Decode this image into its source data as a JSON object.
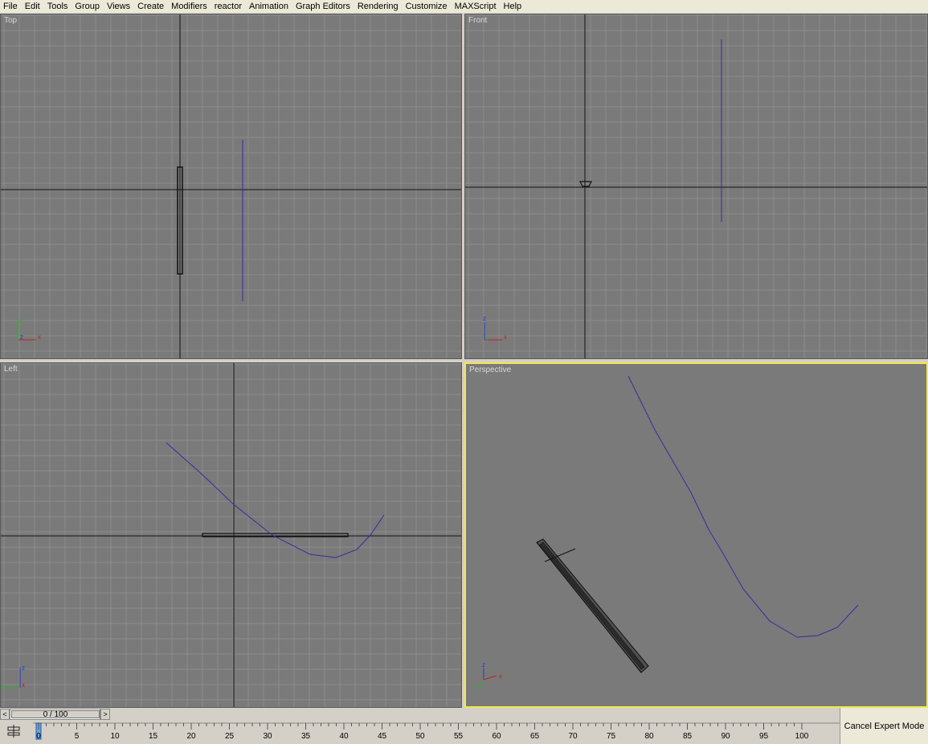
{
  "menu": [
    "File",
    "Edit",
    "Tools",
    "Group",
    "Views",
    "Create",
    "Modifiers",
    "reactor",
    "Animation",
    "Graph Editors",
    "Rendering",
    "Customize",
    "MAXScript",
    "Help"
  ],
  "viewports": {
    "top": {
      "label": "Top",
      "axes": {
        "up": "y",
        "right": "x",
        "center": "z"
      }
    },
    "front": {
      "label": "Front",
      "axes": {
        "up": "z",
        "right": "x",
        "center": "y"
      }
    },
    "left": {
      "label": "Left",
      "axes": {
        "up": "z",
        "right": "x",
        "center": "y"
      }
    },
    "perspective": {
      "label": "Perspective",
      "axes": {
        "up": "z",
        "right": "x",
        "center": "y"
      }
    }
  },
  "time_slider": {
    "value": "0 / 100",
    "prev": "<",
    "next": ">"
  },
  "timeline": {
    "ticks": [
      "0",
      "5",
      "10",
      "15",
      "20",
      "25",
      "30",
      "35",
      "40",
      "45",
      "50",
      "55",
      "60",
      "65",
      "70",
      "75",
      "80",
      "85",
      "90",
      "95",
      "100"
    ]
  },
  "status": {
    "expert_mode_button": "Cancel Expert Mode"
  },
  "colors": {
    "viewport_bg": "#7a7a7a",
    "grid": "#8c8c8c",
    "active_border": "#f2e84b",
    "spline": "#3a2aa0"
  }
}
